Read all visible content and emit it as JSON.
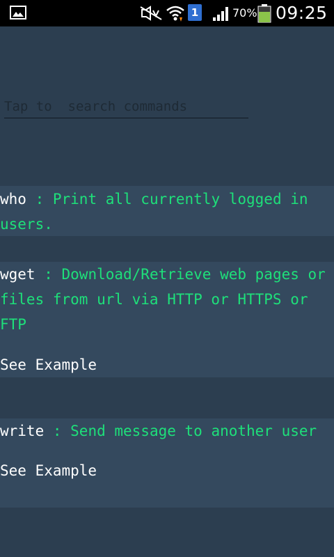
{
  "status_bar": {
    "battery_percent": "70%",
    "time": "09:25",
    "sim_label": "1",
    "battery_level": 0.7,
    "colors": {
      "background": "#000000",
      "sim": "#2f6fd1",
      "battery": "#8bc34a"
    },
    "icons": [
      "gallery-icon",
      "mute-icon",
      "wifi-icon",
      "sim-icon",
      "signal-icon",
      "battery-icon"
    ]
  },
  "search": {
    "placeholder": "Tap to  search commands",
    "value": ""
  },
  "commands": [
    {
      "name": "who",
      "separator": " : ",
      "description": "Print all currently logged in users.",
      "example_label": null
    },
    {
      "name": "wget",
      "separator": " : ",
      "description": "Download/Retrieve web pages or files from url via HTTP or HTTPS or FTP",
      "example_label": "See Example"
    },
    {
      "name": "write",
      "separator": " : ",
      "description": "Send message to another user",
      "example_label": "See Example"
    }
  ],
  "colors": {
    "background": "#2c3e50",
    "card": "#34495e",
    "command": "#ffffff",
    "description": "#1ee07a"
  }
}
